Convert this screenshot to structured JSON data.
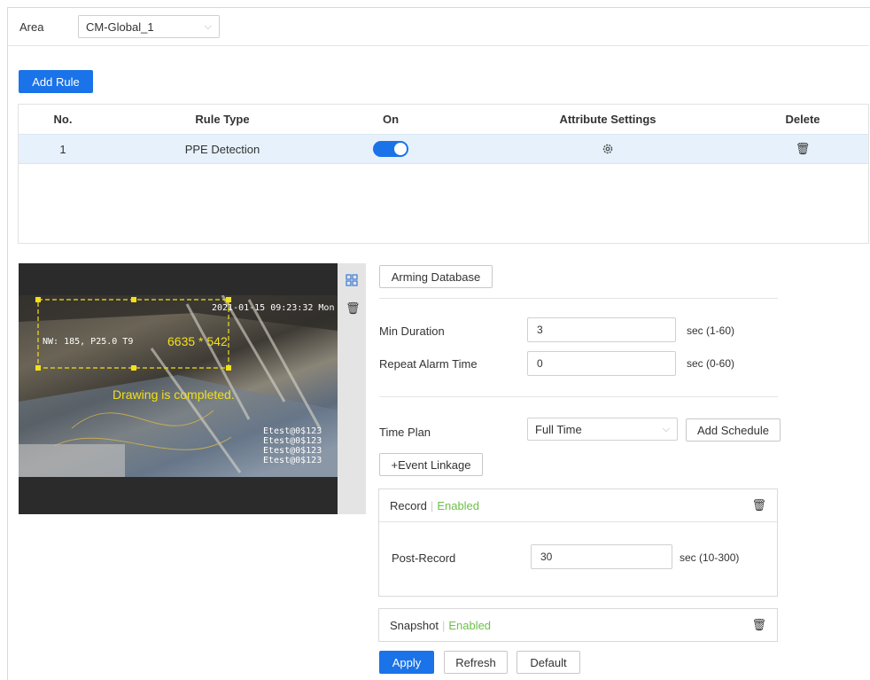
{
  "area": {
    "label": "Area",
    "value": "CM-Global_1"
  },
  "add_rule_label": "Add Rule",
  "table": {
    "headers": {
      "no": "No.",
      "rule_type": "Rule Type",
      "on": "On",
      "attribute": "Attribute Settings",
      "delete": "Delete"
    },
    "rows": [
      {
        "no": "1",
        "rule_type": "PPE Detection",
        "on": true
      }
    ]
  },
  "video": {
    "timestamp": "2021-01-15 09:23:32 Mon",
    "coords": "NW: 185, P25.0 T9",
    "size": "6635 * 542",
    "drawing_status": "Drawing is completed.",
    "osd_lines": [
      "Etest@0$123",
      "Etest@0$123",
      "Etest@0$123",
      "Etest@0$123"
    ]
  },
  "arming_database_label": "Arming Database",
  "min_duration": {
    "label": "Min Duration",
    "value": "3",
    "unit": "sec (1-60)"
  },
  "repeat_alarm": {
    "label": "Repeat Alarm Time",
    "value": "0",
    "unit": "sec (0-60)"
  },
  "time_plan": {
    "label": "Time Plan",
    "value": "Full Time",
    "add_schedule_label": "Add Schedule"
  },
  "event_linkage_label": "+Event Linkage",
  "record": {
    "title": "Record",
    "status": "Enabled",
    "post_label": "Post-Record",
    "post_value": "30",
    "post_unit": "sec (10-300)"
  },
  "snapshot": {
    "title": "Snapshot",
    "status": "Enabled"
  },
  "actions": {
    "apply": "Apply",
    "refresh": "Refresh",
    "default": "Default"
  },
  "colors": {
    "accent": "#1a73e8",
    "enabled": "#6cc04a",
    "selected_row": "#e6f1fb"
  }
}
